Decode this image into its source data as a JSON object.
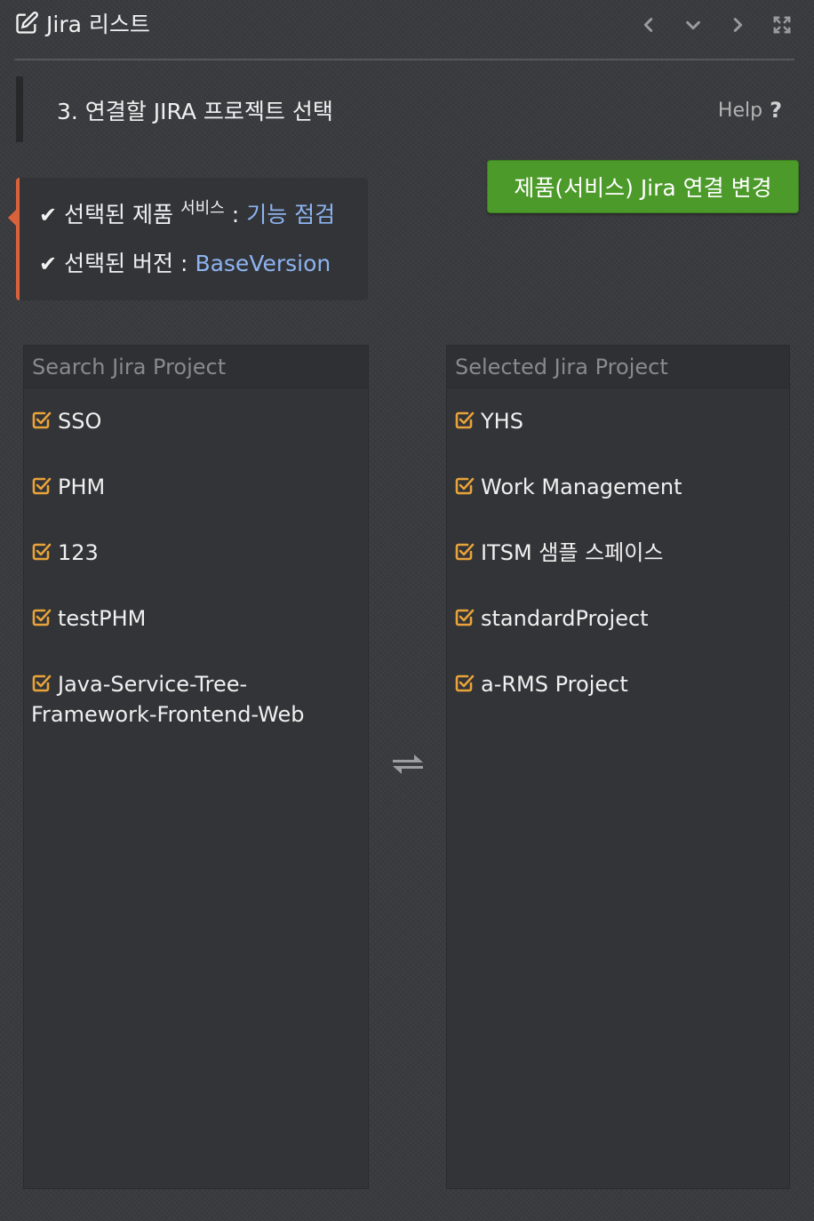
{
  "window": {
    "title": "Jira 리스트",
    "title_icon": "edit-icon",
    "tools": [
      "chevron-left-icon",
      "chevron-down-icon",
      "chevron-right-icon",
      "expand-icon"
    ]
  },
  "step": {
    "title": "3. 연결할 JIRA 프로젝트 선택",
    "help_label": "Help"
  },
  "selection": {
    "product_label": "선택된 제품",
    "product_sup": "서비스",
    "separator": ":",
    "product_value": "기능 점검",
    "version_label": "선택된 버전 :",
    "version_value": "BaseVersion"
  },
  "change_button_label": "제품(서비스) Jira 연결 변경",
  "left_panel": {
    "placeholder": "Search Jira Project",
    "items": [
      "SSO",
      "PHM",
      "123",
      "testPHM",
      "Java-Service-Tree-Framework-Frontend-Web"
    ]
  },
  "right_panel": {
    "placeholder": "Selected Jira Project",
    "items": [
      "YHS",
      "Work Management",
      "ITSM 샘플 스페이스",
      "standardProject",
      "a-RMS Project"
    ]
  },
  "colors": {
    "background": "#3a3b3e",
    "accent_orange": "#d9623a",
    "checkbox_orange": "#e8a33a",
    "link_blue": "#8db4f0",
    "button_green": "#4c9a2a"
  }
}
